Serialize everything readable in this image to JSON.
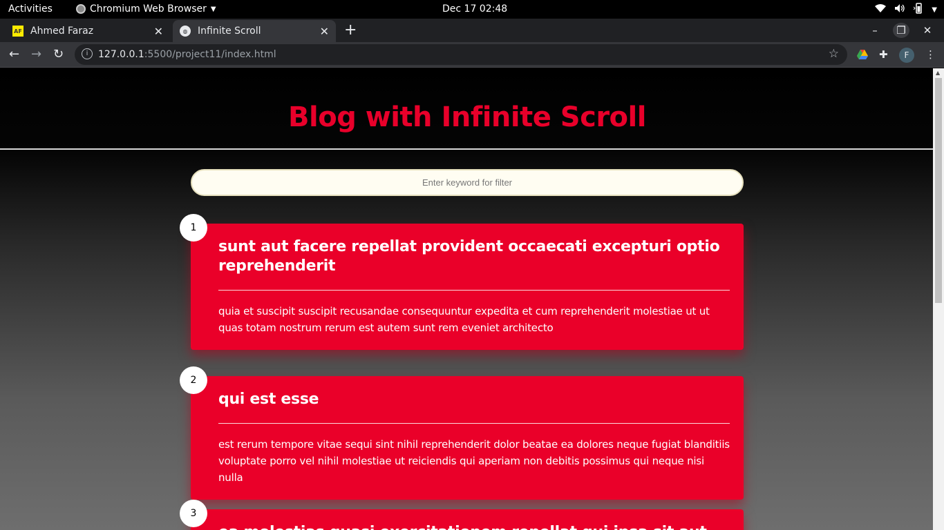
{
  "system": {
    "activities": "Activities",
    "app_name": "Chromium Web Browser",
    "clock": "Dec 17  02:48"
  },
  "tabs": [
    {
      "label": "Ahmed Faraz",
      "favicon": "AF"
    },
    {
      "label": "Infinite Scroll"
    }
  ],
  "address_bar": {
    "host": "127.0.0.1",
    "rest": ":5500/project11/index.html"
  },
  "profile_initial": "F",
  "page": {
    "title": "Blog with Infinite Scroll",
    "filter_placeholder": "Enter keyword for filter",
    "posts": [
      {
        "number": "1",
        "title": "sunt aut facere repellat provident occaecati excepturi optio reprehenderit",
        "body": "quia et suscipit suscipit recusandae consequuntur expedita et cum reprehenderit molestiae ut ut quas totam nostrum rerum est autem sunt rem eveniet architecto"
      },
      {
        "number": "2",
        "title": "qui est esse",
        "body": "est rerum tempore vitae sequi sint nihil reprehenderit dolor beatae ea dolores neque fugiat blanditiis voluptate porro vel nihil molestiae ut reiciendis qui aperiam non debitis possimus qui neque nisi nulla"
      },
      {
        "number": "3",
        "title": "ea molestias quasi exercitationem repellat qui ipsa sit aut",
        "body": ""
      }
    ]
  },
  "colors": {
    "accent": "#ea0029",
    "title_red": "#e8002a"
  }
}
